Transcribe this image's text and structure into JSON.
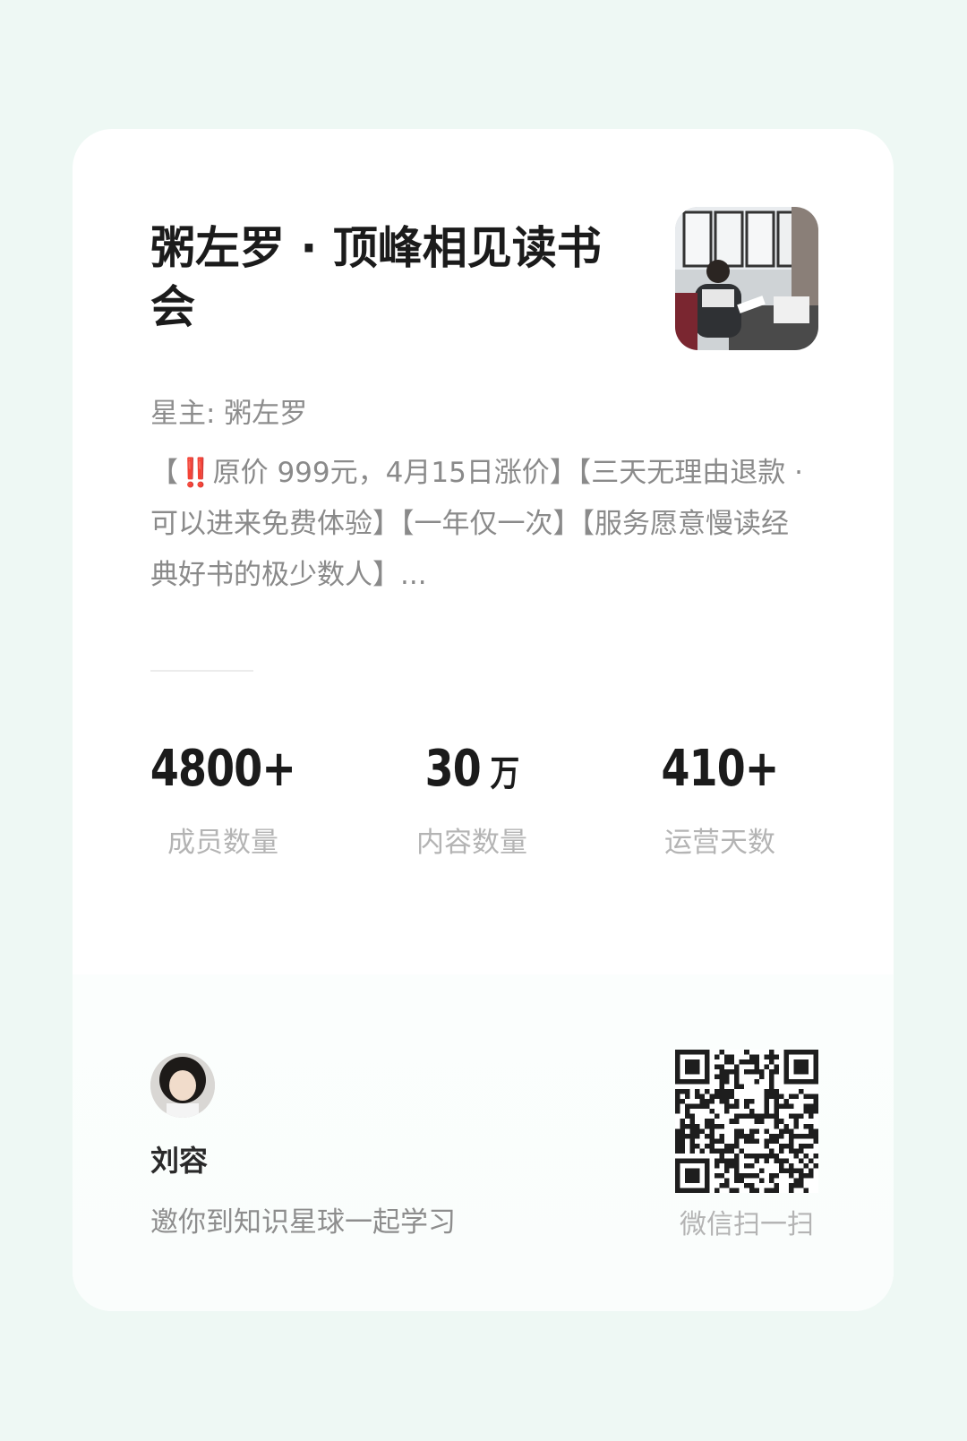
{
  "card": {
    "title": "粥左罗 · 顶峰相见读书会",
    "owner": "星主: 粥左罗",
    "description_prefix": "【",
    "description_emphasis": "‼️",
    "description_body": "原价 999元，4月15日涨价】【三天无理由退款 · 可以进来免费体验】【一年仅一次】【服务愿意慢读经典好书的极少数人】...",
    "cover_icon": "reading-man-photo"
  },
  "stats": [
    {
      "value": "4800+",
      "unit": "",
      "label": "成员数量"
    },
    {
      "value": "30",
      "unit": " 万",
      "label": "内容数量"
    },
    {
      "value": "410+",
      "unit": "",
      "label": "运营天数"
    }
  ],
  "invite": {
    "name": "刘容",
    "text": "邀你到知识星球一起学习",
    "avatar_icon": "user-avatar-photo"
  },
  "qr": {
    "label": "微信扫一扫",
    "icon": "qr-code"
  }
}
